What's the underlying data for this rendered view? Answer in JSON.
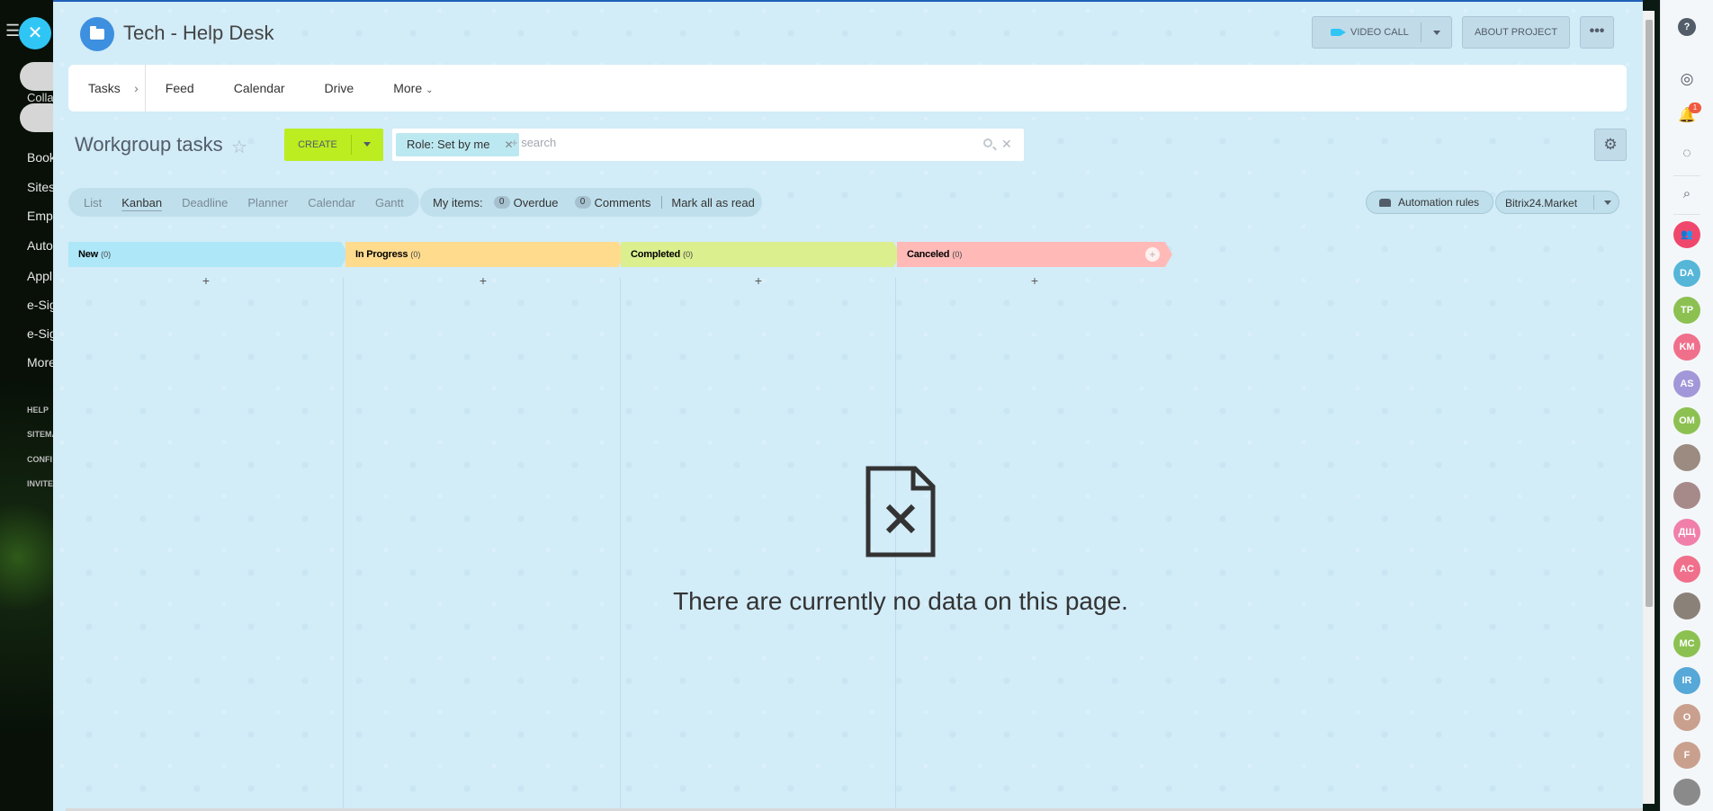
{
  "left_menu": {
    "collab": "Colla",
    "items": [
      "Book",
      "Sites",
      "Empl",
      "Auto",
      "Appl",
      "e-Sig",
      "e-Sig",
      "More"
    ],
    "small_items": [
      "HELP",
      "SITEMA",
      "CONFI",
      "INVITE"
    ]
  },
  "header": {
    "title": "Tech - Help Desk",
    "video_call_label": "VIDEO CALL",
    "about_label": "ABOUT PROJECT",
    "more_dots": "•••"
  },
  "nav": {
    "items": [
      {
        "label": "Tasks"
      },
      {
        "label": "Feed"
      },
      {
        "label": "Calendar"
      },
      {
        "label": "Drive"
      },
      {
        "label": "More"
      }
    ]
  },
  "toolbar": {
    "title": "Workgroup tasks",
    "create_label": "CREATE",
    "filter_tag": "Role: Set by me",
    "search_placeholder": "+ search"
  },
  "views": {
    "items": [
      "List",
      "Kanban",
      "Deadline",
      "Planner",
      "Calendar",
      "Gantt"
    ],
    "active": "Kanban"
  },
  "counters": {
    "my_items_label": "My items:",
    "overdue_count": "0",
    "overdue_label": "Overdue",
    "comments_count": "0",
    "comments_label": "Comments",
    "mark_all_label": "Mark all as read"
  },
  "actions": {
    "automation_label": "Automation rules",
    "market_label": "Bitrix24.Market"
  },
  "kanban": {
    "columns": [
      {
        "name": "New",
        "count": "(0)",
        "color": "#aee7f8"
      },
      {
        "name": "In Progress",
        "count": "(0)",
        "color": "#ffdb8e"
      },
      {
        "name": "Completed",
        "count": "(0)",
        "color": "#dcef8e"
      },
      {
        "name": "Canceled",
        "count": "(0)",
        "color": "#ffbab8"
      }
    ],
    "add_symbol": "+"
  },
  "empty_state": {
    "message": "There are currently no data on this page."
  },
  "right_bar": {
    "notification_count": "1",
    "avatars": [
      {
        "initials": "DA",
        "color": "#55b6d8"
      },
      {
        "initials": "TP",
        "color": "#8cc152"
      },
      {
        "initials": "KM",
        "color": "#f06f8b"
      },
      {
        "initials": "AS",
        "color": "#a297d8"
      },
      {
        "initials": "OM",
        "color": "#8cc152"
      },
      {
        "initials": "",
        "color": "#9b8b80"
      },
      {
        "initials": "",
        "color": "#a68a8a"
      },
      {
        "initials": "ДЩ",
        "color": "#f07faa"
      },
      {
        "initials": "AC",
        "color": "#f06f8b"
      },
      {
        "initials": "",
        "color": "#8a8178"
      },
      {
        "initials": "MC",
        "color": "#8cc152"
      },
      {
        "initials": "IR",
        "color": "#55a8d8"
      },
      {
        "initials": "O",
        "color": "#c9a08e"
      },
      {
        "initials": "F",
        "color": "#c9a08e"
      },
      {
        "initials": "",
        "color": "#8a8a8a"
      }
    ]
  }
}
